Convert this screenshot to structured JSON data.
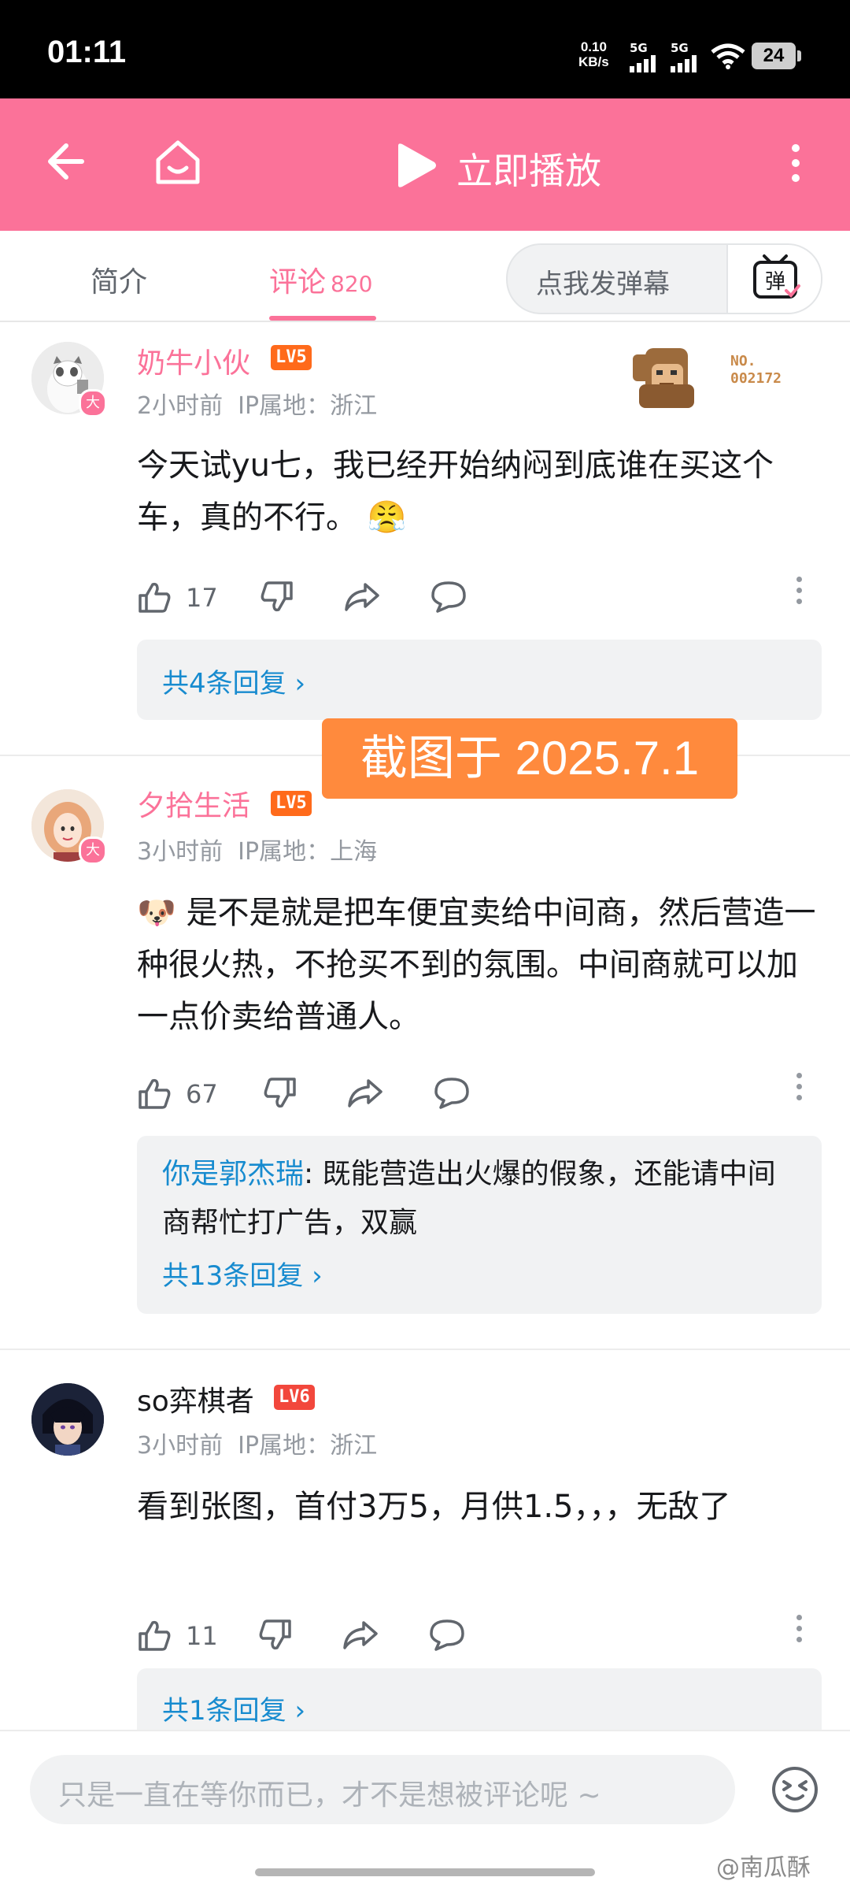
{
  "status_bar": {
    "time": "01:11",
    "net_speed_value": "0.10",
    "net_speed_unit": "KB/s",
    "signal_1": "5G",
    "signal_2": "5G",
    "battery": "24"
  },
  "top_bar": {
    "back_icon": "back-arrow-icon",
    "home_icon": "home-icon",
    "play_label": "立即播放",
    "more_icon": "more-icon"
  },
  "tabs": {
    "intro": "简介",
    "comments": "评论",
    "comments_count": "820",
    "danmaku_placeholder": "点我发弹幕",
    "danmaku_button": "弹"
  },
  "comments": [
    {
      "username": "奶牛小伙",
      "level": "LV5",
      "badge": "大",
      "time": "2小时前",
      "ip": "IP属地：浙江",
      "text": "今天试yu七，我已经开始纳闷到底谁在买这个车，真的不行。",
      "emoji": "😤",
      "likes": "17",
      "decoration_no": "NO.",
      "decoration_id": "002172",
      "replies_link": "共4条回复 ›"
    },
    {
      "username": "夕拾生活",
      "level": "LV5",
      "badge": "大",
      "time": "3小时前",
      "ip": "IP属地：上海",
      "emoji": "🐶",
      "text": "是不是就是把车便宜卖给中间商，然后营造一种很火热，不抢买不到的氛围。中间商就可以加一点价卖给普通人。",
      "likes": "67",
      "reply_user": "你是郭杰瑞",
      "reply_text": ": 既能营造出火爆的假象，还能请中间商帮忙打广告，双赢",
      "replies_link": "共13条回复 ›"
    },
    {
      "username": "so弈棋者",
      "level": "LV6",
      "time": "3小时前",
      "ip": "IP属地：浙江",
      "text": "看到张图，首付3万5，月供1.5，，，无敌了",
      "likes": "11",
      "replies_link": "共1条回复 ›"
    }
  ],
  "stamp": "截图于 2025.7.1",
  "bottom_bar": {
    "placeholder": "只是一直在等你而已，才不是想被评论呢 ~",
    "emoji_icon": "emoji-icon"
  },
  "watermark": "@南瓜酥",
  "colors": {
    "brand_pink": "#fb7299",
    "link_blue": "#178bcf",
    "level_orange": "#ff6a1b",
    "stamp_orange": "#ff8a3d"
  }
}
